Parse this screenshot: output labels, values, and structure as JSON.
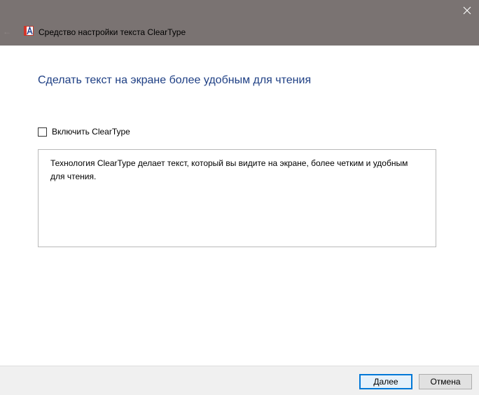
{
  "window": {
    "title": "Средство настройки текста ClearType",
    "back_icon": "back-arrow-icon",
    "app_icon": "cleartype-app-icon",
    "close_icon": "close-icon"
  },
  "main": {
    "heading": "Сделать текст на экране более удобным для чтения",
    "checkbox_label": "Включить ClearType",
    "checkbox_checked": false,
    "description": "Технология ClearType делает текст, который вы видите на экране, более четким и удобным для чтения."
  },
  "footer": {
    "next_label": "Далее",
    "cancel_label": "Отмена"
  },
  "colors": {
    "titlebar": "#7a7372",
    "heading": "#1e3f84",
    "default_button_border": "#0078d7",
    "footer_bg": "#f0f0f0"
  }
}
